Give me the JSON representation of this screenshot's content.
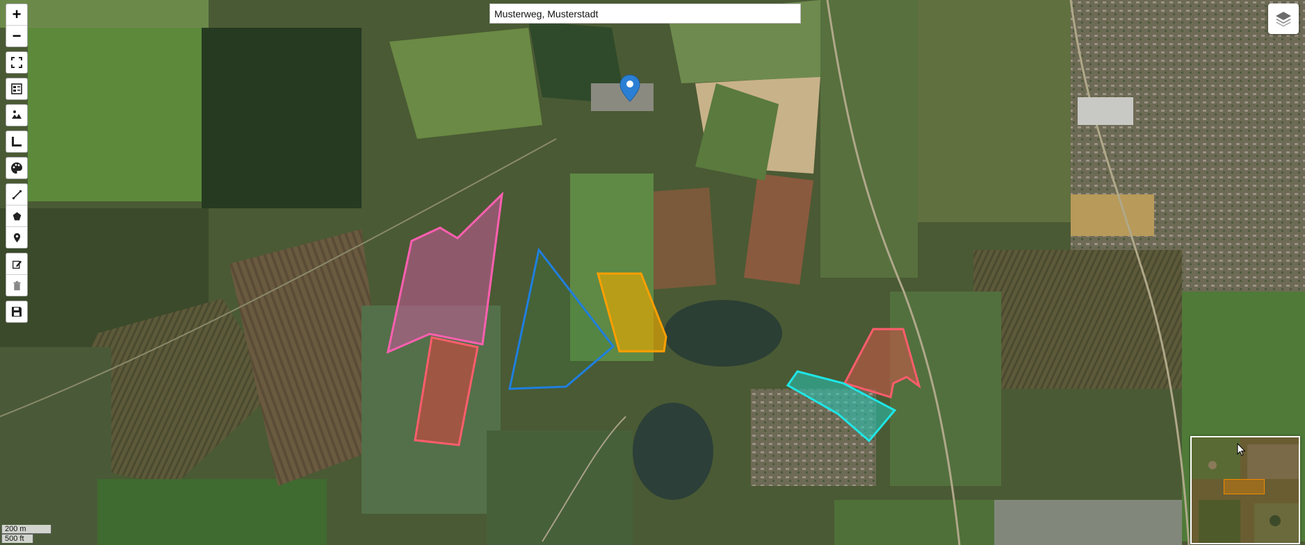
{
  "search": {
    "value": "Musterweg, Musterstadt"
  },
  "toolbar": {
    "zoom_in": "+",
    "zoom_out": "−"
  },
  "scale": {
    "metric": "200 m",
    "imperial": "500 ft"
  },
  "features": [
    {
      "name": "pink-field",
      "stroke": "#ff5fb0",
      "fill": "#c85a9a"
    },
    {
      "name": "red-field-west",
      "stroke": "#ff5d6c",
      "fill": "#d2453f"
    },
    {
      "name": "blue-field",
      "stroke": "#1f7fe0",
      "fill": "#3a7a3a"
    },
    {
      "name": "orange-field",
      "stroke": "#ff9f00",
      "fill": "#e6a800"
    },
    {
      "name": "red-field-east",
      "stroke": "#ff5d6c",
      "fill": "#c8584a"
    },
    {
      "name": "cyan-field",
      "stroke": "#1fe6e6",
      "fill": "#27c9b8"
    }
  ],
  "colors": {
    "marker": "#2a7fd4",
    "minimap_extent": "#f08a00"
  }
}
